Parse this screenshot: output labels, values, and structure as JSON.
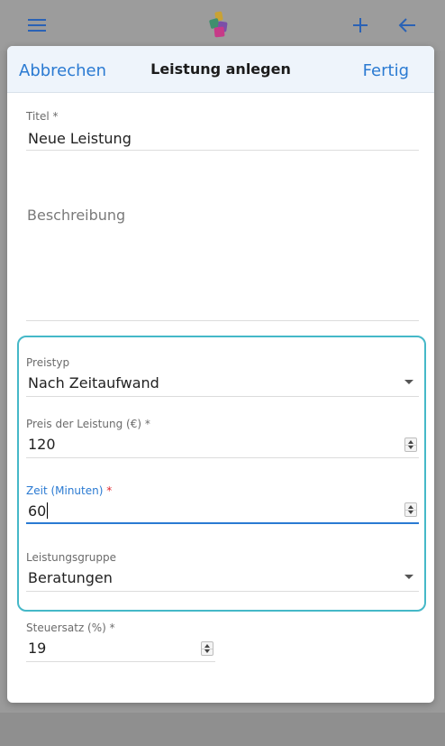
{
  "app_bar": {
    "icons": {
      "menu": "hamburger-menu-icon",
      "logo": "app-logo",
      "add": "plus-icon",
      "back": "arrow-left-icon"
    }
  },
  "colors": {
    "accent": "#2a7ad2",
    "group_border": "#45b8c8",
    "required": "#e0282f",
    "header_bg": "#eef4fb"
  },
  "dialog": {
    "cancel_label": "Abbrechen",
    "title": "Leistung anlegen",
    "done_label": "Fertig"
  },
  "form": {
    "title": {
      "label": "Titel",
      "required_mark": "*",
      "value": "Neue Leistung"
    },
    "description": {
      "placeholder": "Beschreibung",
      "value": ""
    },
    "price_type": {
      "label": "Preistyp",
      "value": "Nach Zeitaufwand"
    },
    "price": {
      "label": "Preis der Leistung (€)",
      "required_mark": "*",
      "value": "120"
    },
    "time": {
      "label": "Zeit (Minuten)",
      "required_mark": "*",
      "value": "60"
    },
    "service_group": {
      "label": "Leistungsgruppe",
      "value": "Beratungen"
    },
    "tax_rate": {
      "label": "Steuersatz (%)",
      "required_mark": "*",
      "value": "19"
    }
  }
}
